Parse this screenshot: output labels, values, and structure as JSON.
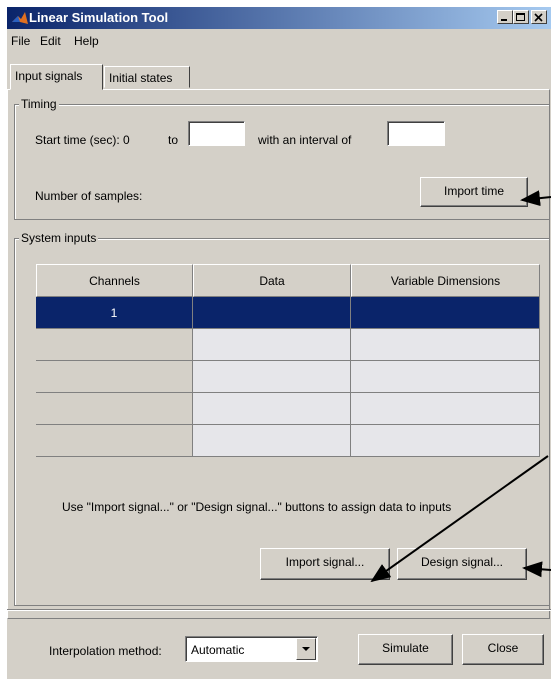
{
  "window": {
    "title": "Linear Simulation Tool"
  },
  "menu": [
    "File",
    "Edit",
    "Help"
  ],
  "tabs": [
    "Input signals",
    "Initial states"
  ],
  "timing": {
    "legend": "Timing",
    "start_label": "Start time (sec): 0",
    "to_label": "to",
    "end_value": "",
    "interval_label": "with an interval of",
    "interval_value": "",
    "samples_label": "Number of samples:",
    "import_time": "Import time"
  },
  "system_inputs": {
    "legend": "System inputs",
    "columns": [
      "Channels",
      "Data",
      "Variable Dimensions"
    ],
    "rows": [
      {
        "channel": "1",
        "data": "",
        "dims": "",
        "selected": true
      },
      {
        "channel": "",
        "data": "",
        "dims": ""
      },
      {
        "channel": "",
        "data": "",
        "dims": ""
      },
      {
        "channel": "",
        "data": "",
        "dims": ""
      },
      {
        "channel": "",
        "data": "",
        "dims": ""
      }
    ],
    "hint": "Use \"Import signal...\" or \"Design signal...\" buttons to assign data to inputs",
    "import_signal": "Import signal...",
    "design_signal": "Design signal..."
  },
  "footer": {
    "interp_label": "Interpolation method:",
    "interp_value": "Automatic",
    "simulate": "Simulate",
    "close": "Close"
  },
  "colors": {
    "title_start": "#0a246a",
    "title_end": "#a6caf0",
    "selection": "#0a246a",
    "face": "#d4d0c8"
  }
}
